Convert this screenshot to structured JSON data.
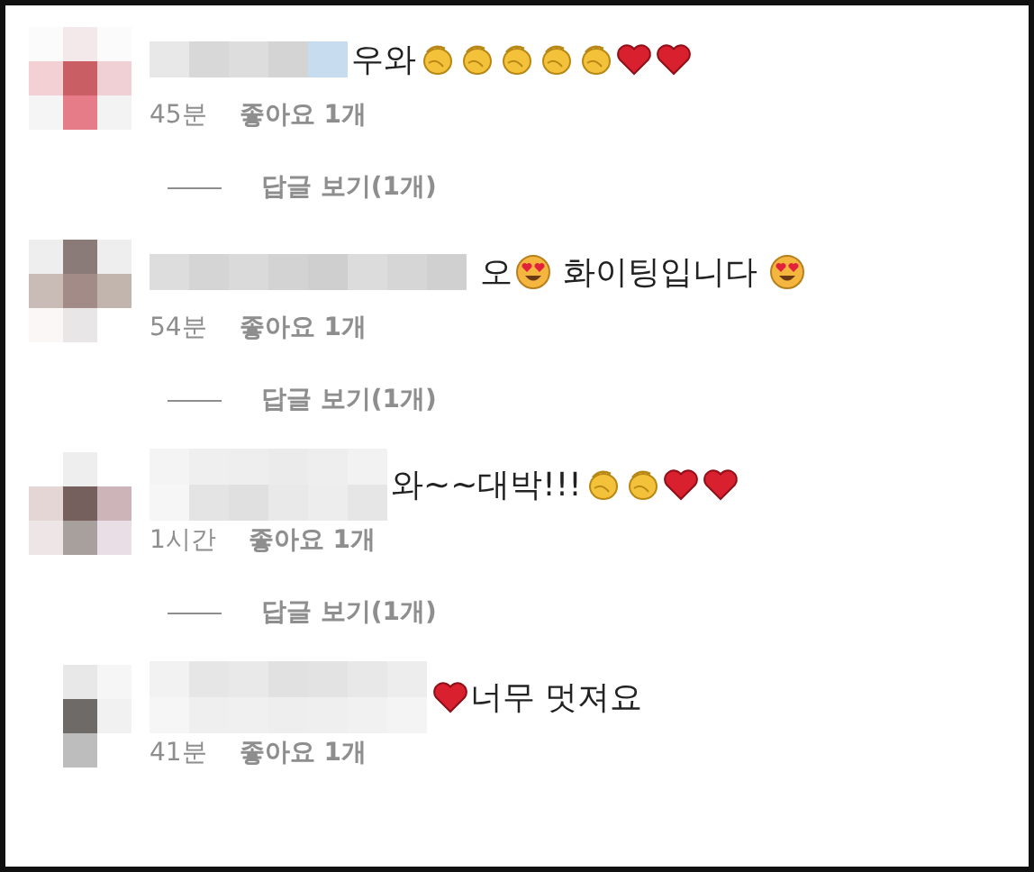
{
  "comments": [
    {
      "segments": [
        {
          "kind": "text",
          "text": "우와"
        },
        {
          "kind": "clap"
        },
        {
          "kind": "clap"
        },
        {
          "kind": "clap"
        },
        {
          "kind": "clap"
        },
        {
          "kind": "clap"
        },
        {
          "kind": "heart"
        },
        {
          "kind": "heart"
        }
      ],
      "time": "45분",
      "likes": "좋아요 1개",
      "replies": "답글 보기(1개)"
    },
    {
      "segments": [
        {
          "kind": "text",
          "text": " 오"
        },
        {
          "kind": "heart-eyes"
        },
        {
          "kind": "text",
          "text": " 화이팅입니다 "
        },
        {
          "kind": "heart-eyes"
        }
      ],
      "time": "54분",
      "likes": "좋아요 1개",
      "replies": "답글 보기(1개)"
    },
    {
      "segments": [
        {
          "kind": "text",
          "text": "와~~대박!!!"
        },
        {
          "kind": "clap"
        },
        {
          "kind": "clap"
        },
        {
          "kind": "heart"
        },
        {
          "kind": "heart"
        }
      ],
      "time": "1시간",
      "likes": "좋아요 1개",
      "replies": "답글 보기(1개)"
    },
    {
      "segments": [
        {
          "kind": "heart"
        },
        {
          "kind": "text",
          "text": "너무 멋져요"
        }
      ],
      "time": "41분",
      "likes": "좋아요 1개"
    }
  ]
}
